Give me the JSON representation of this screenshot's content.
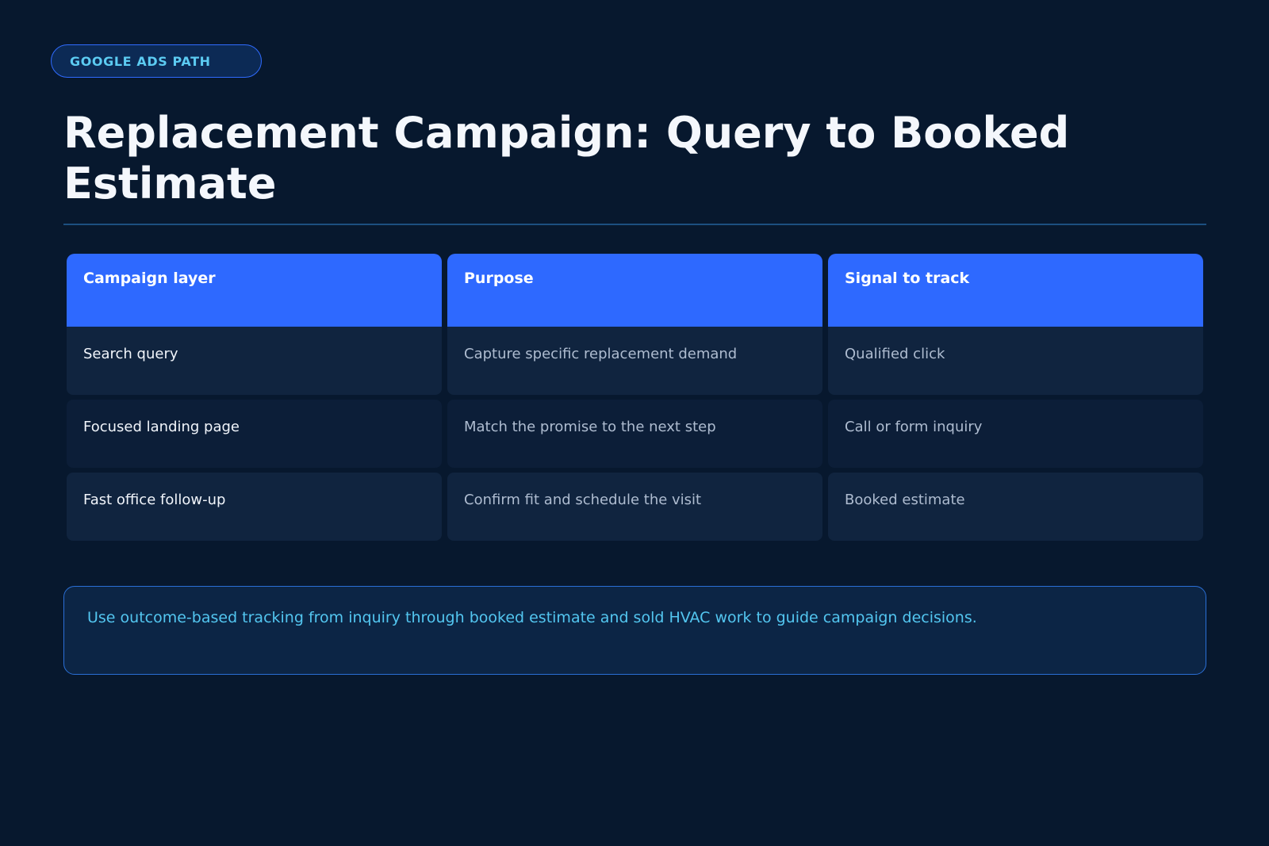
{
  "badge": {
    "label": "GOOGLE ADS PATH"
  },
  "page": {
    "title": "Replacement Campaign: Query to Booked Estimate"
  },
  "table": {
    "headers": [
      "Campaign layer",
      "Purpose",
      "Signal to track"
    ],
    "rows": [
      [
        "Search query",
        "Capture specific replacement demand",
        "Qualified click"
      ],
      [
        "Focused landing page",
        "Match the promise to the next step",
        "Call or form inquiry"
      ],
      [
        "Fast office follow-up",
        "Confirm fit and schedule the visit",
        "Booked estimate"
      ]
    ]
  },
  "note": {
    "text": "Use outcome-based tracking from inquiry through booked estimate and sold HVAC work to guide campaign decisions."
  },
  "colors": {
    "background": "#07182e",
    "accent": "#2e69ff",
    "highlight_text": "#53c6f0"
  }
}
